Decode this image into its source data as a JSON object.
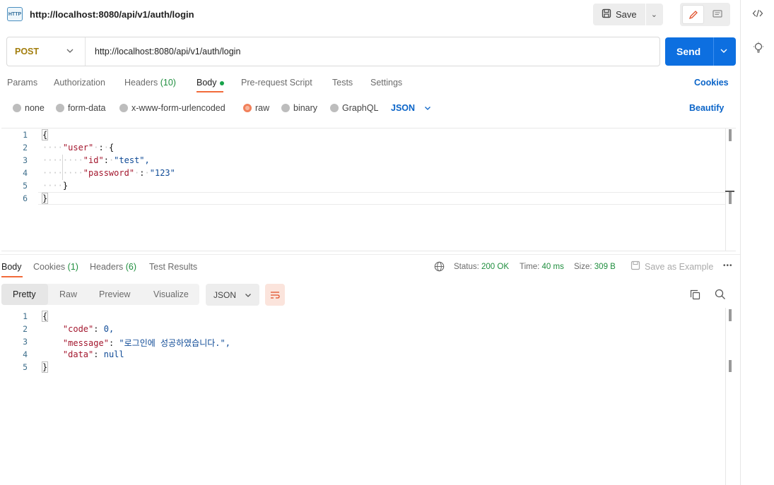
{
  "header": {
    "http_icon": "HTTP",
    "request_title": "http://localhost:8080/api/v1/auth/login",
    "save_label": "Save"
  },
  "request": {
    "method": "POST",
    "url": "http://localhost:8080/api/v1/auth/login",
    "send_label": "Send"
  },
  "request_tabs": {
    "params": "Params",
    "authorization": "Authorization",
    "headers": "Headers",
    "headers_count": "(10)",
    "body": "Body",
    "prerequest": "Pre-request Script",
    "tests": "Tests",
    "settings": "Settings",
    "cookies": "Cookies"
  },
  "body_modes": {
    "none": "none",
    "form_data": "form-data",
    "urlencoded": "x-www-form-urlencoded",
    "raw": "raw",
    "binary": "binary",
    "graphql": "GraphQL",
    "format": "JSON",
    "beautify": "Beautify"
  },
  "request_body": {
    "line_numbers": [
      "1",
      "2",
      "3",
      "4",
      "5",
      "6"
    ],
    "open_brace": "{",
    "user_key": "\"user\"",
    "id_key": "\"id\"",
    "id_value": "\"test\",",
    "password_key": "\"password\"",
    "password_value": "\"123\"",
    "inner_close": "}",
    "close_brace": "}"
  },
  "response_tabs": {
    "body": "Body",
    "cookies": "Cookies",
    "cookies_count": "(1)",
    "headers": "Headers",
    "headers_count": "(6)",
    "test_results": "Test Results"
  },
  "response_stats": {
    "status_label": "Status:",
    "status_value": "200 OK",
    "time_label": "Time:",
    "time_value": "40 ms",
    "size_label": "Size:",
    "size_value": "309 B",
    "save_example": "Save as Example",
    "more": "•••"
  },
  "response_view": {
    "pretty": "Pretty",
    "raw": "Raw",
    "preview": "Preview",
    "visualize": "Visualize",
    "format": "JSON"
  },
  "response_body": {
    "line_numbers": [
      "1",
      "2",
      "3",
      "4",
      "5"
    ],
    "open_brace": "{",
    "code_key": "\"code\"",
    "code_value": "0,",
    "message_key": "\"message\"",
    "message_value": "\"로그인에 성공하였습니다.\",",
    "data_key": "\"data\"",
    "data_value": "null",
    "close_brace": "}"
  },
  "colors": {
    "accent_orange": "#f26b3a",
    "send_blue": "#0d6fe0",
    "method_post": "#a27d0c",
    "status_green": "#1f8e3e"
  },
  "icons": [
    "http-request-icon",
    "save-icon",
    "chevron-down-icon",
    "pencil-icon",
    "comment-icon",
    "code-icon",
    "lightbulb-icon",
    "globe-icon",
    "wrap-lines-icon",
    "copy-icon",
    "search-icon"
  ]
}
